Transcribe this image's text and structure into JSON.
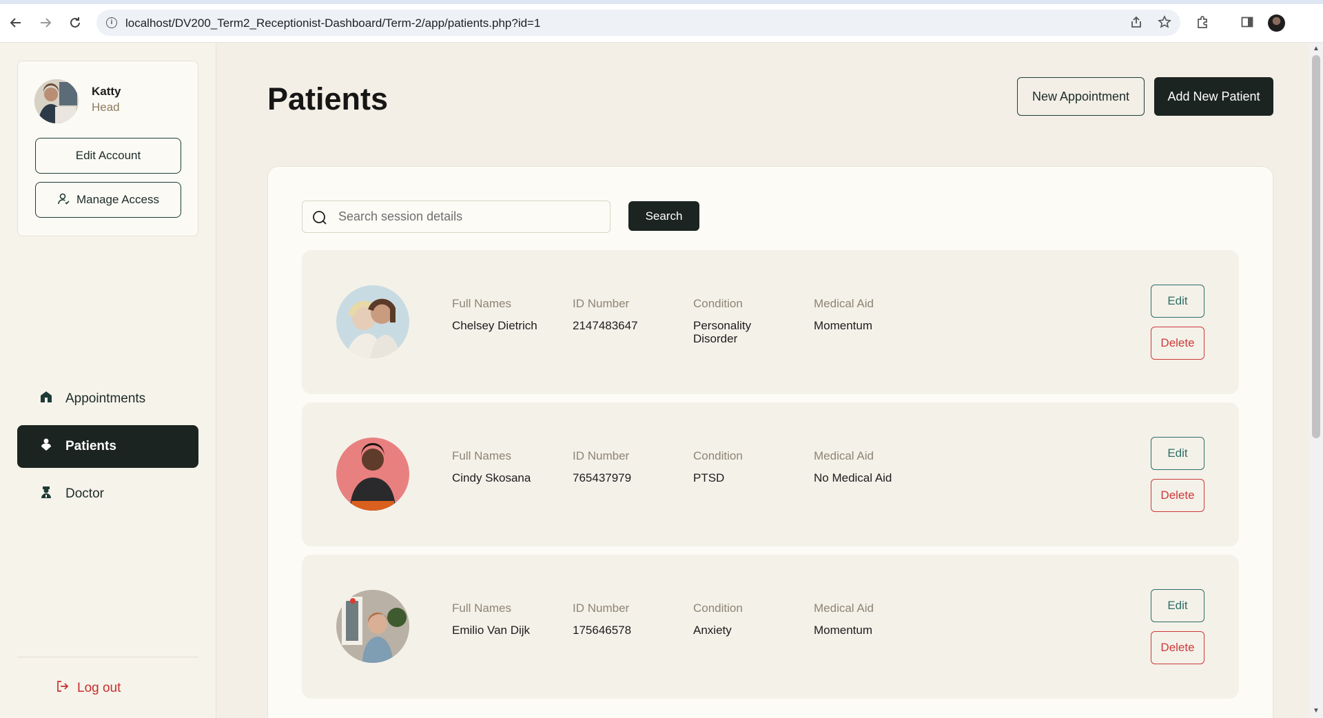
{
  "browser": {
    "url": "localhost/DV200_Term2_Receptionist-Dashboard/Term-2/app/patients.php?id=1"
  },
  "user": {
    "name": "Katty",
    "role": "Head"
  },
  "sidebar": {
    "edit_account_label": "Edit Account",
    "manage_access_label": "Manage Access",
    "items": [
      {
        "label": "Appointments",
        "icon": "home-icon",
        "active": false
      },
      {
        "label": "Patients",
        "icon": "person-icon",
        "active": true
      },
      {
        "label": "Doctor",
        "icon": "doctor-icon",
        "active": false
      }
    ],
    "logout_label": "Log out"
  },
  "header": {
    "title": "Patients",
    "new_appointment_label": "New Appointment",
    "add_patient_label": "Add New Patient"
  },
  "search": {
    "placeholder": "Search session details",
    "button_label": "Search"
  },
  "columns": {
    "full_names": "Full Names",
    "id_number": "ID Number",
    "condition": "Condition",
    "medical_aid": "Medical Aid"
  },
  "actions": {
    "edit": "Edit",
    "delete": "Delete"
  },
  "patients": [
    {
      "full_name": "Chelsey Dietrich",
      "id_number": "2147483647",
      "condition": "Personality Disorder",
      "medical_aid": "Momentum"
    },
    {
      "full_name": "Cindy Skosana",
      "id_number": "765437979",
      "condition": "PTSD",
      "medical_aid": "No Medical Aid"
    },
    {
      "full_name": "Emilio Van Dijk",
      "id_number": "175646578",
      "condition": "Anxiety",
      "medical_aid": "Momentum"
    }
  ],
  "colors": {
    "dark": "#1b2421",
    "accent_teal": "#2c6e64",
    "danger": "#cc3a3a",
    "page_bg": "#f3efe6",
    "role_text": "#8d7b5f"
  }
}
